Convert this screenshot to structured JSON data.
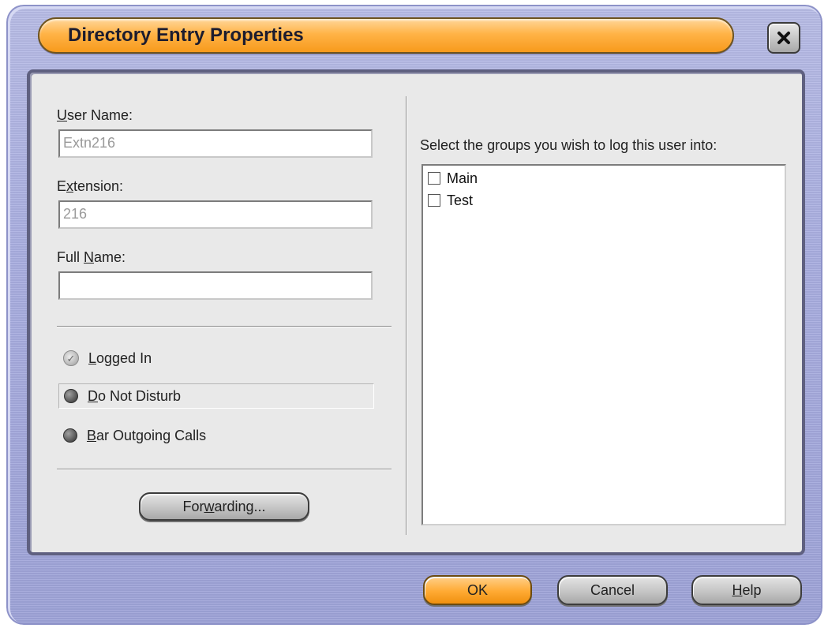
{
  "window": {
    "title": "Directory Entry Properties",
    "close_icon": "close-icon"
  },
  "left": {
    "user_name_label_pre": "",
    "user_name_label_u": "U",
    "user_name_label_post": "ser Name:",
    "user_name_value": "Extn216",
    "extension_label_pre": "E",
    "extension_label_u": "x",
    "extension_label_post": "tension:",
    "extension_value": "216",
    "full_name_label_pre": "Full ",
    "full_name_label_u": "N",
    "full_name_label_post": "ame:",
    "full_name_value": "",
    "logged_in_u": "L",
    "logged_in_post": "ogged In",
    "dnd_u": "D",
    "dnd_post": "o Not Disturb",
    "bar_u": "B",
    "bar_post": "ar Outgoing Calls",
    "forwarding_pre": "For",
    "forwarding_u": "w",
    "forwarding_post": "arding..."
  },
  "right": {
    "groups_label_pre": "Select the ",
    "groups_label_u": "g",
    "groups_label_post": "roups you wish to log this user into:",
    "groups": [
      {
        "label": "Main",
        "checked": false
      },
      {
        "label": "Test",
        "checked": false
      }
    ]
  },
  "footer": {
    "ok": "OK",
    "cancel": "Cancel",
    "help_u": "H",
    "help_post": "elp"
  },
  "colors": {
    "accent": "#ffaa33",
    "frame": "#a9aee0"
  }
}
